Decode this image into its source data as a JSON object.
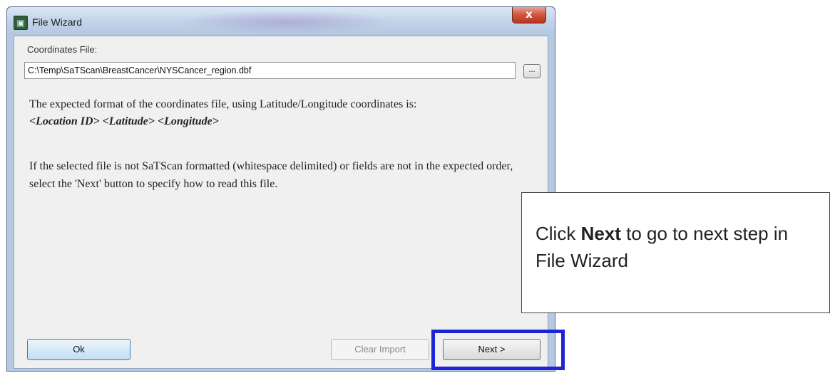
{
  "window": {
    "title": "File Wizard",
    "close_symbol": "x",
    "icon": "app-icon"
  },
  "coordinates": {
    "label": "Coordinates File:",
    "value": "C:\\Temp\\SaTScan\\BreastCancer\\NYSCancer_region.dbf",
    "browse_label": "..."
  },
  "description": {
    "line1": "The expected format of the coordinates file, using Latitude/Longitude coordinates is:",
    "format": "<Location ID> <Latitude> <Longitude>",
    "paragraph2": "If the selected file is not SaTScan formatted (whitespace delimited) or fields are not in the expected order, select the 'Next' button to specify how to read this file."
  },
  "buttons": {
    "ok": "Ok",
    "clear_import": "Clear Import",
    "next": "Next >"
  },
  "callout": {
    "prefix": "Click ",
    "bold": "Next",
    "suffix": " to go to next step in File Wizard"
  },
  "colors": {
    "highlight": "#1d24d6",
    "close_button": "#c9452e"
  }
}
